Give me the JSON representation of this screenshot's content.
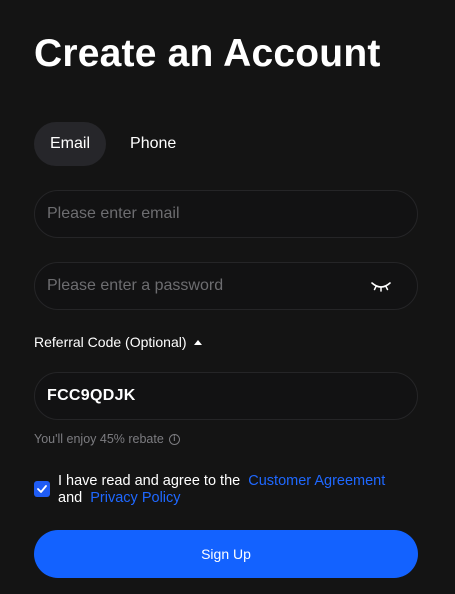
{
  "title": "Create an Account",
  "tabs": [
    {
      "label": "Email",
      "active": true
    },
    {
      "label": "Phone",
      "active": false
    }
  ],
  "email": {
    "placeholder": "Please enter email",
    "value": ""
  },
  "password": {
    "placeholder": "Please enter a password",
    "value": "",
    "visibility_icon": "eye-closed-icon"
  },
  "referral": {
    "label": "Referral Code (Optional)",
    "expanded": true,
    "code": "FCC9QDJK",
    "rebate_note": "You'll enjoy 45% rebate"
  },
  "agreement": {
    "checked": true,
    "prefix": "I have read and agree to the",
    "customer_agreement": "Customer Agreement",
    "conjunction": "and",
    "privacy_policy": "Privacy Policy"
  },
  "signup_label": "Sign Up",
  "colors": {
    "background": "#141414",
    "accent": "#1362ff",
    "link": "#1f68ff",
    "field_border": "#252527",
    "muted_text": "#7c7c80"
  }
}
